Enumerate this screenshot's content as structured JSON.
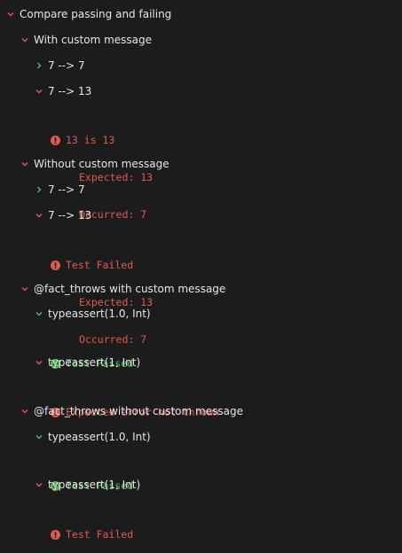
{
  "colors": {
    "background": "#1c1c1c",
    "text": "#e6e6e6",
    "chevron_expanded": "#e05a50",
    "chevron_collapsed": "#4fb85a",
    "fail": "#e05a50",
    "pass": "#4fb85a"
  },
  "tree": {
    "root_label": "Compare passing and failing",
    "group1": {
      "label": "With custom message",
      "item1_label": "7 --> 7",
      "item2_label": "7 --> 13",
      "item2_result_title": "13 is 13",
      "item2_expected": "Expected: 13",
      "item2_occurred": "Occurred: 7"
    },
    "group2": {
      "label": "Without custom message",
      "item1_label": "7 --> 7",
      "item2_label": "7 --> 13",
      "item2_result_title": "Test Failed",
      "item2_expected": "Expected: 13",
      "item2_occurred": "Occurred: 7"
    },
    "group3": {
      "label": "@fact_throws with custom message",
      "item1_label": "typeassert(1.0, Int)",
      "item1_result": "Test Passed",
      "item2_label": "typeassert(1, Int)",
      "item2_result": "Expected error not thrown"
    },
    "group4": {
      "label": "@fact_throws without custom message",
      "item1_label": "typeassert(1.0, Int)",
      "item1_result": "Test Passed",
      "item2_label": "typeassert(1, Int)",
      "item2_result": "Test Failed"
    }
  }
}
